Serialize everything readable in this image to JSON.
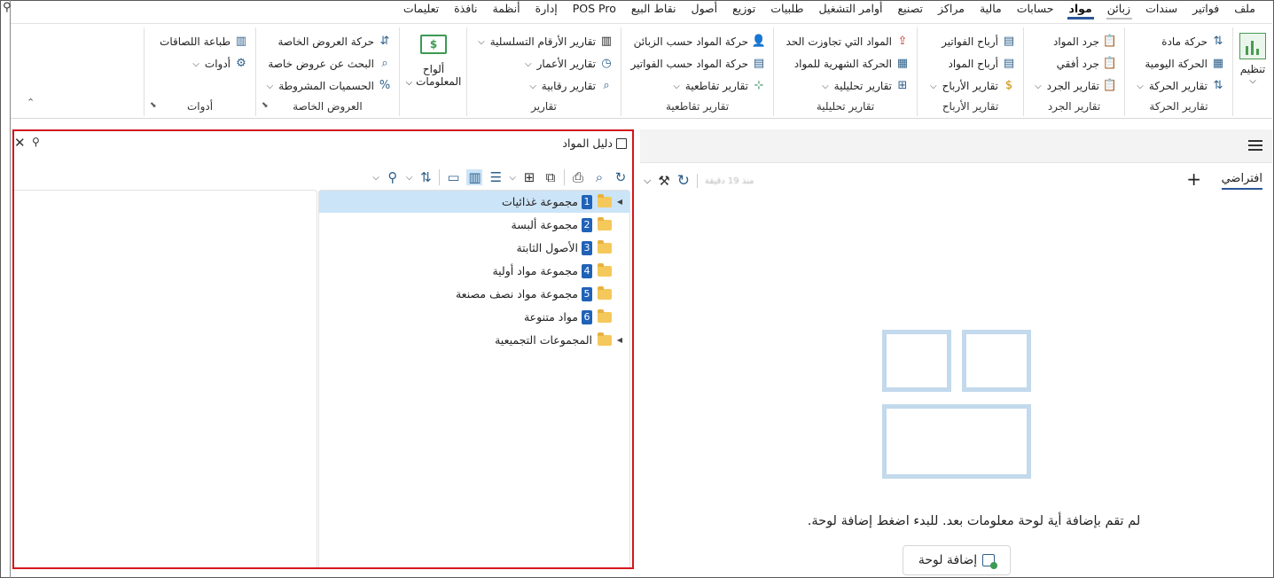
{
  "menu": {
    "items": [
      "ملف",
      "فواتير",
      "سندات",
      "زبائن",
      "مواد",
      "حسابات",
      "مالية",
      "مراكز",
      "تصنيع",
      "أوامر التشغيل",
      "طلبيات",
      "توزيع",
      "أصول",
      "نقاط البيع",
      "POS Pro",
      "إدارة",
      "أنظمة",
      "نافذة",
      "تعليمات"
    ],
    "active": "مواد",
    "underlined": "زبائن"
  },
  "ribbon": {
    "organize": {
      "label": "تنظيم"
    },
    "movement_reports": {
      "title": "تقارير الحركة",
      "items": [
        "حركة مادة",
        "الحركة اليومية",
        "تقارير الحركة"
      ]
    },
    "inventory_reports": {
      "title": "تقارير الجرد",
      "items": [
        "جرد المواد",
        "جرد أفقي",
        "تقارير الجرد"
      ]
    },
    "profit_reports": {
      "title": "تقارير الأرباح",
      "items": [
        "أرباح الفواتير",
        "أرباح المواد",
        "تقارير الأرباح"
      ]
    },
    "analytic_reports": {
      "title": "تقارير تحليلية",
      "items": [
        "المواد التي تجاوزت الحد",
        "الحركة الشهرية للمواد",
        "تقارير تحليلية"
      ]
    },
    "cross_reports": {
      "title": "تقارير تقاطعية",
      "items": [
        "حركة المواد حسب الزبائن",
        "حركة المواد حسب الفواتير",
        "تقارير تقاطعية"
      ]
    },
    "reports": {
      "title": "تقارير",
      "items": [
        "تقارير الأرقام التسلسلية",
        "تقارير الأعمار",
        "تقارير رقابية"
      ]
    },
    "dashboards": {
      "line1": "ألواح",
      "line2": "المعلومات"
    },
    "special_offers": {
      "title": "العروض الخاصة",
      "items": [
        "حركة العروض الخاصة",
        "البحث عن عروض خاصة",
        "الحسميات المشروطة"
      ]
    },
    "tools": {
      "title": "أدوات",
      "items": [
        "طباعة اللصاقات",
        "أدوات"
      ]
    }
  },
  "materials_guide": {
    "title": "دليل المواد",
    "tree": [
      {
        "num": "1",
        "label": "مجموعة غذائيات",
        "expandable": true,
        "selected": true
      },
      {
        "num": "2",
        "label": "مجموعة ألبسة",
        "expandable": false,
        "selected": false
      },
      {
        "num": "3",
        "label": "الأصول الثابتة",
        "expandable": false,
        "selected": false
      },
      {
        "num": "4",
        "label": "مجموعة مواد أولية",
        "expandable": false,
        "selected": false
      },
      {
        "num": "5",
        "label": "مجموعة مواد نصف مصنعة",
        "expandable": false,
        "selected": false
      },
      {
        "num": "6",
        "label": "مواد متنوعة",
        "expandable": false,
        "selected": false
      },
      {
        "num": "",
        "label": "المجموعات التجميعية",
        "expandable": true,
        "selected": false
      }
    ]
  },
  "dashboard": {
    "tab_label": "افتراضي",
    "add_tab": "+",
    "updated_text": "منذ 19 دقيقة",
    "empty_message": "لم تقم بإضافة أية لوحة معلومات بعد. للبدء اضغط إضافة لوحة.",
    "add_board_button": "إضافة لوحة"
  },
  "colors": {
    "accent": "#2b579a",
    "highlight_border": "#d4161c",
    "selected_row": "#cce4f7",
    "badge": "#2062b8"
  }
}
